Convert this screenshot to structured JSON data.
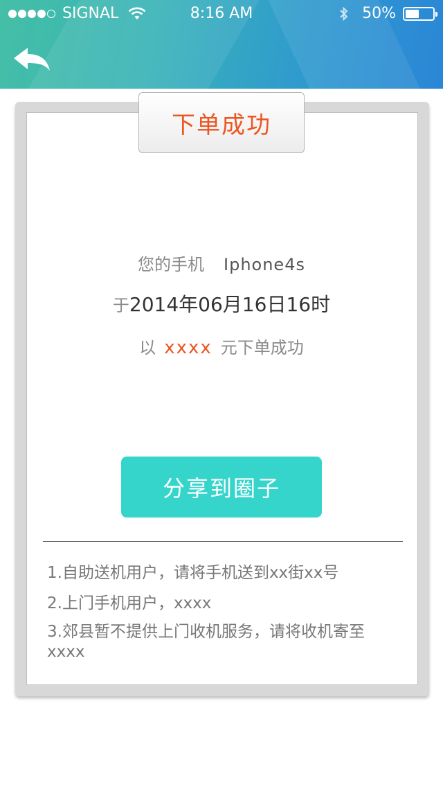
{
  "status_bar": {
    "carrier": "SIGNAL",
    "time": "8:16 AM",
    "battery_percent": "50%",
    "battery_level": 0.5,
    "signal_dots_filled": 4,
    "signal_dots_total": 5
  },
  "header": {
    "back_icon": "back-arrow-icon",
    "colors": {
      "gradient_start": "#45bfa6",
      "gradient_end": "#2a86d6"
    }
  },
  "card": {
    "tab_title": "下单成功",
    "phone_label": "您的手机",
    "phone_model": "Iphone4s",
    "date_prefix": "于",
    "date_text": "2014年06月16日16时",
    "price_prefix": "以",
    "price_value": "xxxx",
    "price_suffix": "元下单成功",
    "share_button": "分享到圈子",
    "notes": [
      "1.自助送机用户，请将手机送到xx街xx号",
      "2.上门手机用户，xxxx",
      "3.郊县暂不提供上门收机服务，请将收机寄至xxxx"
    ]
  },
  "colors": {
    "accent": "#ee5520",
    "button": "#36d5cc"
  }
}
